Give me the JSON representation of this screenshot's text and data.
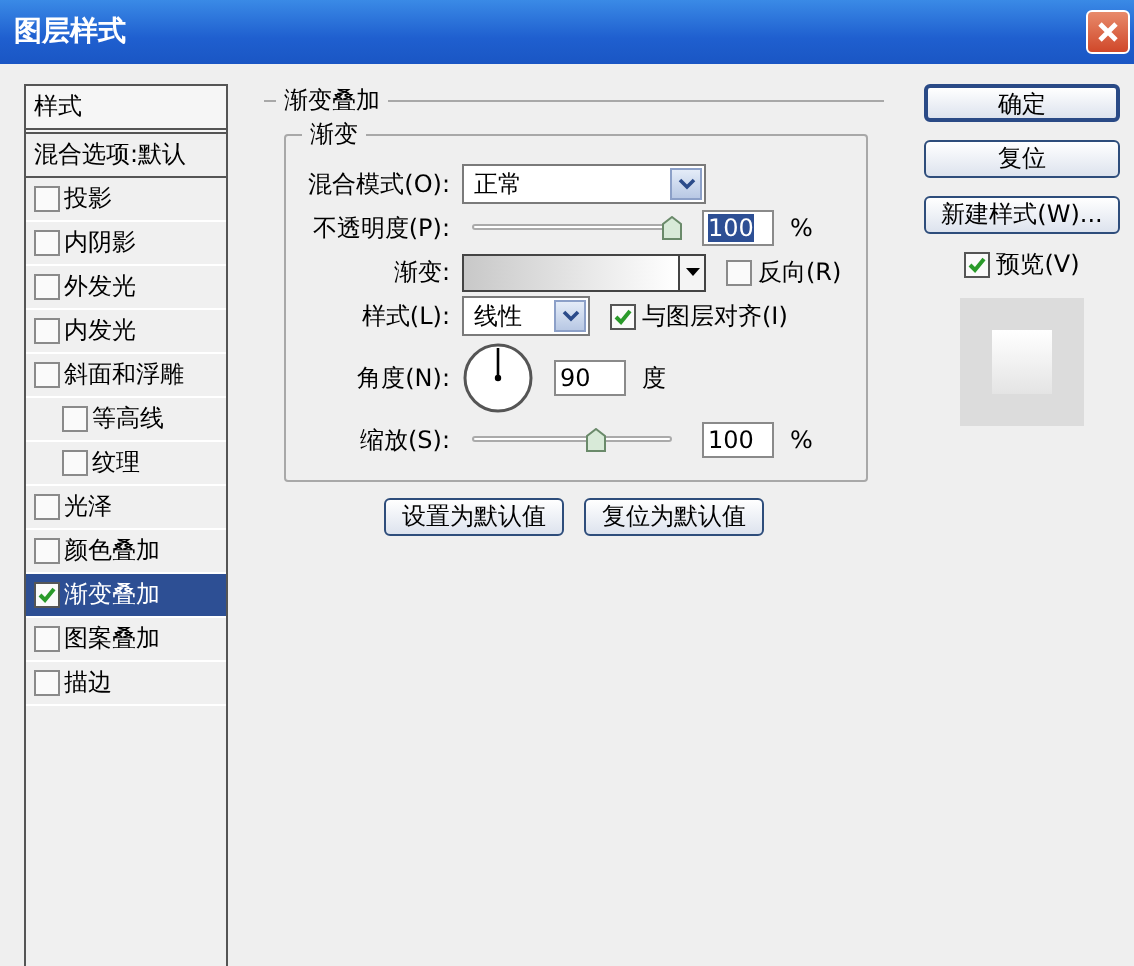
{
  "window": {
    "title": "图层样式"
  },
  "sidebar": {
    "header": "样式",
    "items": [
      {
        "label": "混合选项:默认",
        "kind": "plain",
        "selected": false
      },
      {
        "label": "投影",
        "kind": "check",
        "checked": false,
        "selected": false
      },
      {
        "label": "内阴影",
        "kind": "check",
        "checked": false,
        "selected": false
      },
      {
        "label": "外发光",
        "kind": "check",
        "checked": false,
        "selected": false
      },
      {
        "label": "内发光",
        "kind": "check",
        "checked": false,
        "selected": false
      },
      {
        "label": "斜面和浮雕",
        "kind": "check",
        "checked": false,
        "selected": false,
        "children": [
          {
            "label": "等高线",
            "checked": false,
            "selected": false
          },
          {
            "label": "纹理",
            "checked": false,
            "selected": false
          }
        ]
      },
      {
        "label": "光泽",
        "kind": "check",
        "checked": false,
        "selected": false
      },
      {
        "label": "颜色叠加",
        "kind": "check",
        "checked": false,
        "selected": false
      },
      {
        "label": "渐变叠加",
        "kind": "check",
        "checked": true,
        "selected": true
      },
      {
        "label": "图案叠加",
        "kind": "check",
        "checked": false,
        "selected": false
      },
      {
        "label": "描边",
        "kind": "check",
        "checked": false,
        "selected": false
      }
    ]
  },
  "panel": {
    "title": "渐变叠加",
    "group": {
      "title": "渐变",
      "blend_mode": {
        "label": "混合模式(O):",
        "value": "正常"
      },
      "opacity": {
        "label": "不透明度(P):",
        "level": 1,
        "value": "100",
        "text_selected": true,
        "unit": "%"
      },
      "gradient": {
        "label": "渐变:",
        "reverse": {
          "label": "反向(R)",
          "checked": false
        }
      },
      "style": {
        "label": "样式(L):",
        "value": "线性",
        "align": {
          "label": "与图层对齐(I)",
          "checked": true
        }
      },
      "angle": {
        "label": "角度(N):",
        "value": "90",
        "unit": "度"
      },
      "scale": {
        "label": "缩放(S):",
        "level": 0.62,
        "value": "100",
        "text_selected": false,
        "unit": "%"
      }
    },
    "buttons": [
      "设置为默认值",
      "复位为默认值"
    ]
  },
  "actions": {
    "buttons": [
      {
        "label": "确定",
        "default": true
      },
      {
        "label": "复位",
        "default": false
      },
      {
        "label": "新建样式(W)...",
        "default": false
      }
    ],
    "preview": {
      "label": "预览(V)",
      "checked": true
    }
  }
}
